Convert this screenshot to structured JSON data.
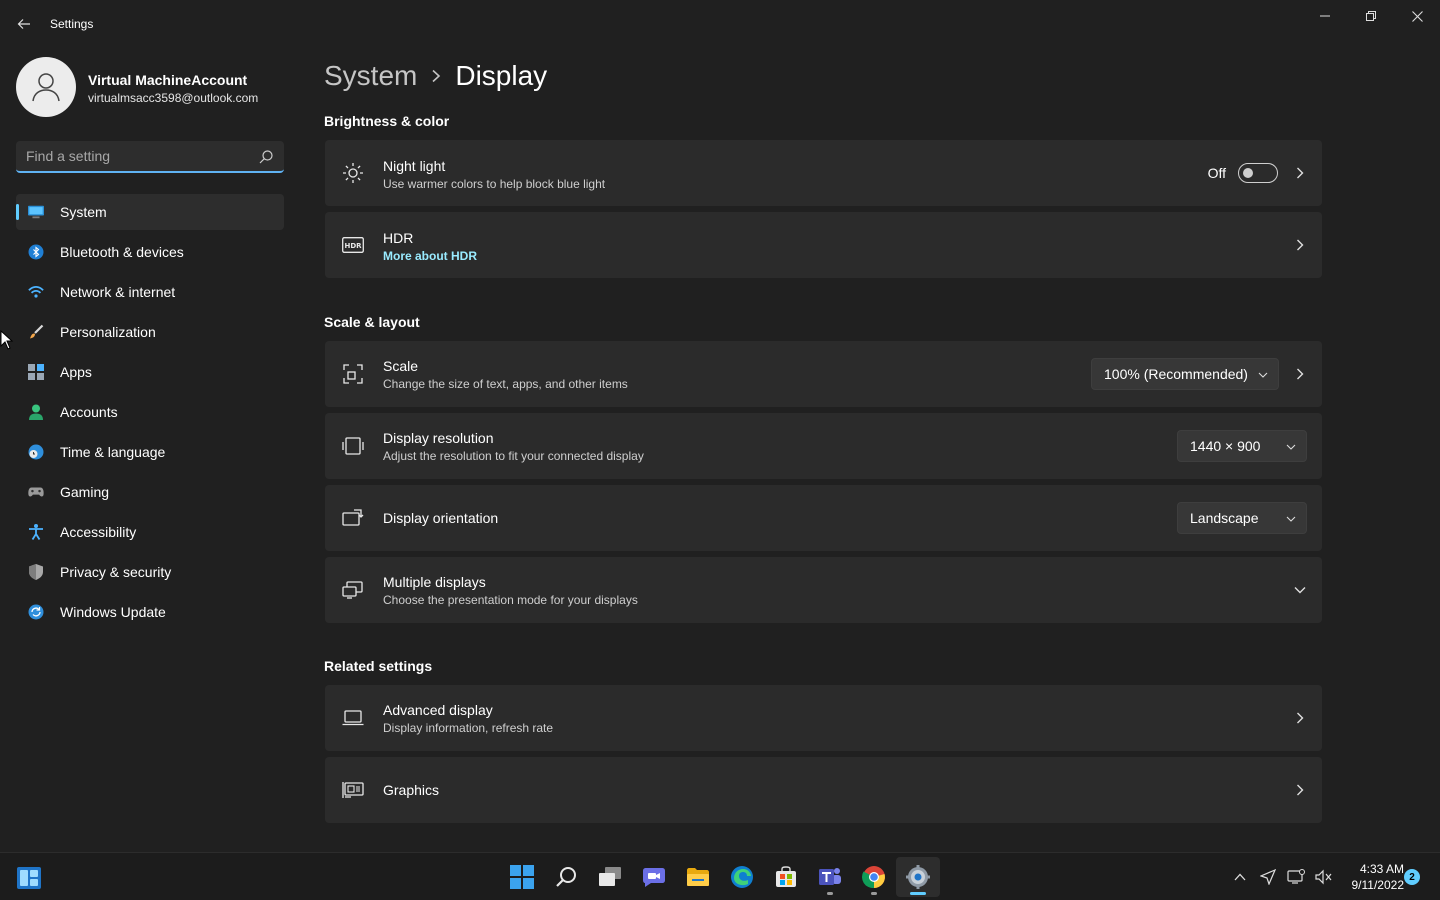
{
  "app": {
    "title": "Settings"
  },
  "profile": {
    "name": "Virtual MachineAccount",
    "email": "virtualmsacc3598@outlook.com"
  },
  "search": {
    "placeholder": "Find a setting"
  },
  "nav": {
    "items": [
      {
        "label": "System",
        "icon": "monitor-icon",
        "active": true
      },
      {
        "label": "Bluetooth & devices",
        "icon": "bluetooth-icon"
      },
      {
        "label": "Network & internet",
        "icon": "wifi-icon"
      },
      {
        "label": "Personalization",
        "icon": "brush-icon"
      },
      {
        "label": "Apps",
        "icon": "apps-icon"
      },
      {
        "label": "Accounts",
        "icon": "person-icon"
      },
      {
        "label": "Time & language",
        "icon": "globe-clock-icon"
      },
      {
        "label": "Gaming",
        "icon": "gamepad-icon"
      },
      {
        "label": "Accessibility",
        "icon": "accessibility-icon"
      },
      {
        "label": "Privacy & security",
        "icon": "shield-icon"
      },
      {
        "label": "Windows Update",
        "icon": "update-icon"
      }
    ]
  },
  "breadcrumb": {
    "parent": "System",
    "current": "Display"
  },
  "sections": {
    "brightness": "Brightness & color",
    "scale_layout": "Scale & layout",
    "related": "Related settings"
  },
  "cards": {
    "night_light": {
      "title": "Night light",
      "subtitle": "Use warmer colors to help block blue light",
      "state_label": "Off",
      "enabled": false
    },
    "hdr": {
      "title": "HDR",
      "link": "More about HDR"
    },
    "scale": {
      "title": "Scale",
      "subtitle": "Change the size of text, apps, and other items",
      "value": "100% (Recommended)"
    },
    "resolution": {
      "title": "Display resolution",
      "subtitle": "Adjust the resolution to fit your connected display",
      "value": "1440 × 900"
    },
    "orientation": {
      "title": "Display orientation",
      "value": "Landscape"
    },
    "multiple": {
      "title": "Multiple displays",
      "subtitle": "Choose the presentation mode for your displays"
    },
    "advanced": {
      "title": "Advanced display",
      "subtitle": "Display information, refresh rate"
    },
    "graphics": {
      "title": "Graphics"
    }
  },
  "taskbar": {
    "apps": [
      "start-icon",
      "search-icon",
      "task-view-icon",
      "chat-icon",
      "file-explorer-icon",
      "edge-icon",
      "store-icon",
      "teams-icon",
      "chrome-icon",
      "settings-icon"
    ],
    "time": "4:33 AM",
    "date": "9/11/2022",
    "notifications": "2"
  },
  "colors": {
    "accent": "#60cdff",
    "background": "#202020",
    "card": "#2b2b2b"
  }
}
